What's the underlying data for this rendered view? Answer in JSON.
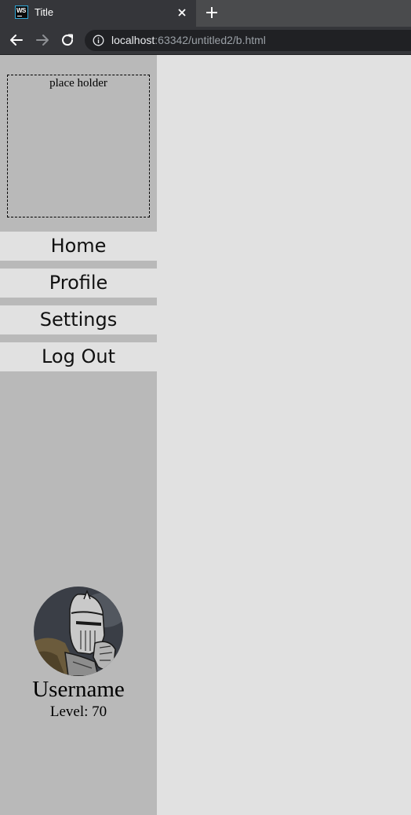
{
  "browser": {
    "tab": {
      "title": "Title",
      "favicon_text": "WS",
      "close_icon": "close-icon"
    },
    "new_tab_icon": "plus-icon",
    "toolbar": {
      "back_icon": "arrow-left-icon",
      "forward_icon": "arrow-right-icon",
      "reload_icon": "reload-icon",
      "info_icon": "info-icon",
      "url_host": "localhost",
      "url_rest": ":63342/untitled2/b.html"
    }
  },
  "sidebar": {
    "placeholder_text": "place holder",
    "nav_items": [
      {
        "label": "Home"
      },
      {
        "label": "Profile"
      },
      {
        "label": "Settings"
      },
      {
        "label": "Log Out"
      }
    ],
    "profile": {
      "username": "Username",
      "level_label": "Level: 70"
    }
  },
  "colors": {
    "sidebar_bg": "#b9b9b9",
    "nav_item_bg": "#e1e1e1",
    "content_bg": "#e1e1e1",
    "chrome_dark": "#202124",
    "chrome_mid": "#35363a"
  }
}
